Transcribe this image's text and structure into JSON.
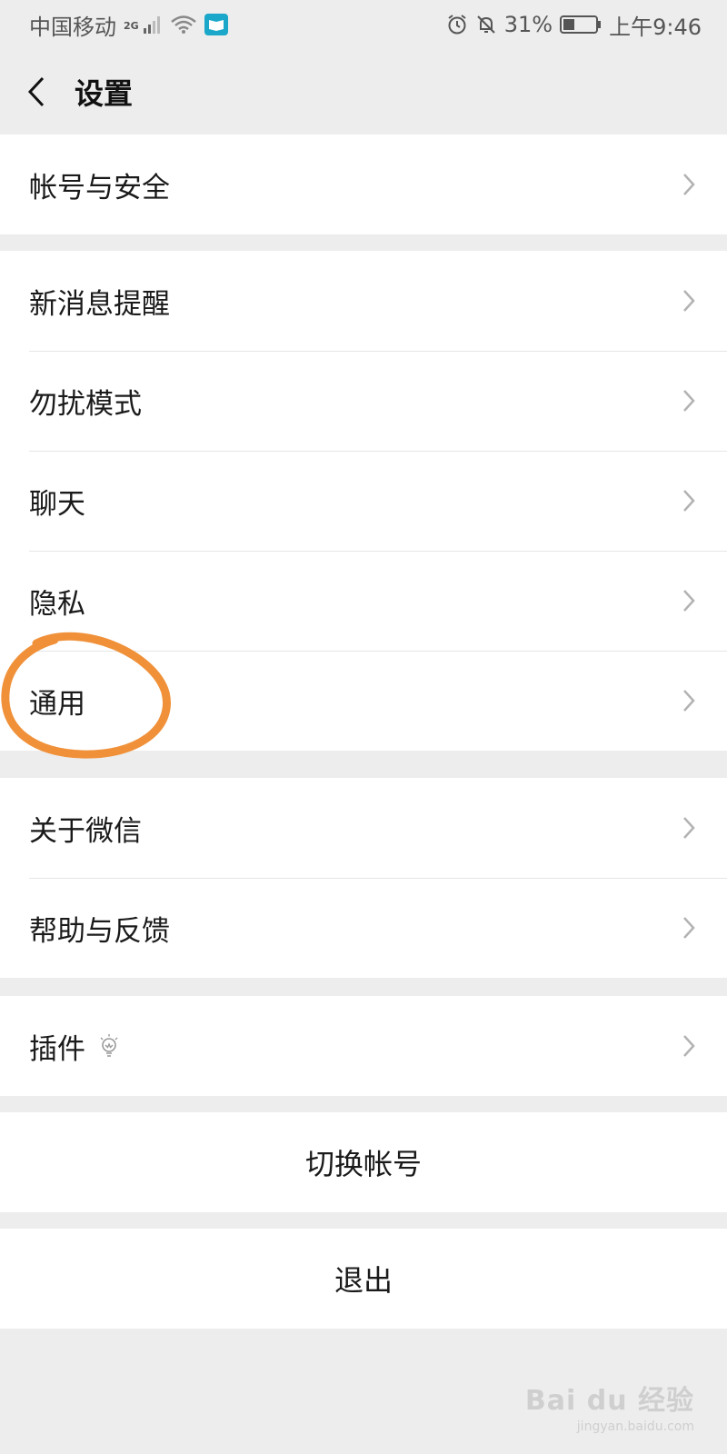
{
  "status_bar": {
    "carrier": "中国移动",
    "network": "2G",
    "battery": "31%",
    "time": "上午9:46",
    "icons": [
      "signal-icon",
      "wifi-icon",
      "app-notification-icon",
      "alarm-icon",
      "mute-icon",
      "battery-icon"
    ]
  },
  "nav": {
    "title": "设置",
    "back_icon": "back-chevron-icon"
  },
  "groups": {
    "account": {
      "items": [
        {
          "label": "帐号与安全"
        }
      ]
    },
    "main": {
      "items": [
        {
          "label": "新消息提醒"
        },
        {
          "label": "勿扰模式"
        },
        {
          "label": "聊天"
        },
        {
          "label": "隐私"
        },
        {
          "label": "通用"
        }
      ]
    },
    "about": {
      "items": [
        {
          "label": "关于微信"
        },
        {
          "label": "帮助与反馈"
        }
      ]
    },
    "plugins": {
      "items": [
        {
          "label": "插件",
          "icon": "lightbulb-icon"
        }
      ]
    },
    "switch_account": {
      "label": "切换帐号"
    },
    "logout": {
      "label": "退出"
    }
  },
  "annotation": {
    "highlight_target": "通用",
    "color": "#f0913a"
  },
  "watermark": {
    "main": "Bai du 经验",
    "sub": "jingyan.baidu.com"
  },
  "colors": {
    "background": "#ededed",
    "cell": "#ffffff",
    "divider": "#e5e5e5",
    "chevron": "#b2b2b2"
  }
}
